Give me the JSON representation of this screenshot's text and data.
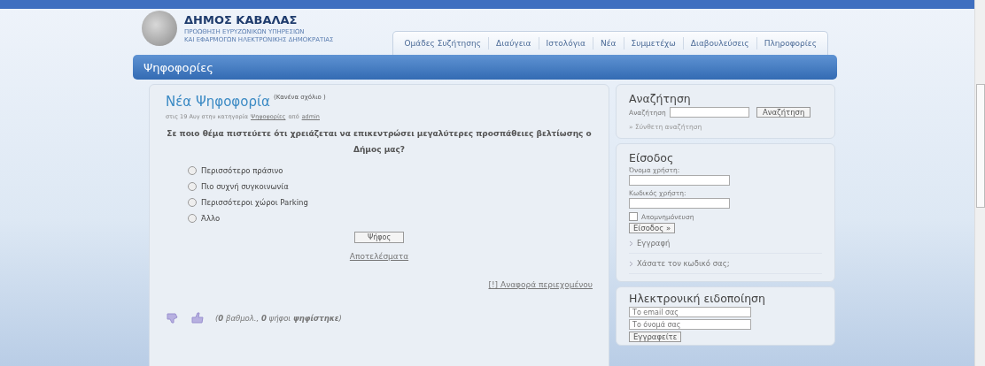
{
  "header": {
    "title": "ΔΗΜΟΣ ΚΑΒΑΛΑΣ",
    "subtitle_lines": [
      "ΠΡΟΩΘΗΣΗ ΕΥΡΥΖΩΝΙΚΩΝ ΥΠΗΡΕΣΙΩΝ",
      "ΚΑΙ ΕΦΑΡΜΟΓΩΝ ΗΛΕΚΤΡΟΝΙΚΗΣ ΔΗΜΟΚΡΑΤΙΑΣ"
    ]
  },
  "tabs": [
    {
      "label": "Ομάδες Συζήτησης",
      "selected": false
    },
    {
      "label": "Διαύγεια",
      "selected": false
    },
    {
      "label": "Ιστολόγια",
      "selected": false
    },
    {
      "label": "Νέα",
      "selected": false
    },
    {
      "label": "Συμμετέχω",
      "selected": false
    },
    {
      "label": "Διαβουλεύσεις",
      "selected": false
    },
    {
      "label": "Πληροφορίες",
      "selected": false
    }
  ],
  "page_title": "Ψηφοφορίες",
  "post": {
    "title": "Νέα Ψηφοφορία",
    "comments": "(Κανένα σχόλιο )",
    "meta_prefix": "στις 19 Αυγ στην κατηγορία",
    "category": "Ψηφοφορίες",
    "meta_by": "από",
    "author": "admin",
    "question": "Σε ποιο θέμα πιστεύετε ότι χρειάζεται να επικεντρώσει μεγαλύτερες προσπάθειες βελτίωσης ο Δήμος μας?",
    "options": [
      {
        "label": "Περισσότερο πράσινο",
        "selected": false
      },
      {
        "label": "Πιο συχνή συγκοινωνία",
        "selected": false
      },
      {
        "label": "Περισσότεροι χώροι Parking",
        "selected": false
      },
      {
        "label": "Άλλο",
        "selected": false
      }
    ],
    "vote_button": "Ψήφος",
    "results_link": "Αποτελέσματα",
    "report_link": "[!] Αναφορά περιεχομένου",
    "rating": "(**0** βαθμολ., **0** ψήφοι **ψηφίστηκε**)"
  },
  "search": {
    "heading": "Αναζήτηση",
    "label": "Αναζήτηση",
    "button": "Αναζήτηση",
    "advanced_link": "» Σύνθετη αναζήτηση"
  },
  "login": {
    "heading": "Είσοδος",
    "username_label": "Όνομα χρήστη:",
    "password_label": "Κωδικός χρήστη:",
    "remember": {
      "label": "Απομνημόνευση",
      "checked": false
    },
    "button": "Είσοδος »",
    "links": [
      "Εγγραφή",
      "Χάσατε τον κωδικό σας;"
    ]
  },
  "notify": {
    "heading": "Ηλεκτρονική ειδοποίηση",
    "email_placeholder": "Το email σας",
    "name_placeholder": "Το όνομά σας",
    "button": "Εγγραφείτε"
  }
}
